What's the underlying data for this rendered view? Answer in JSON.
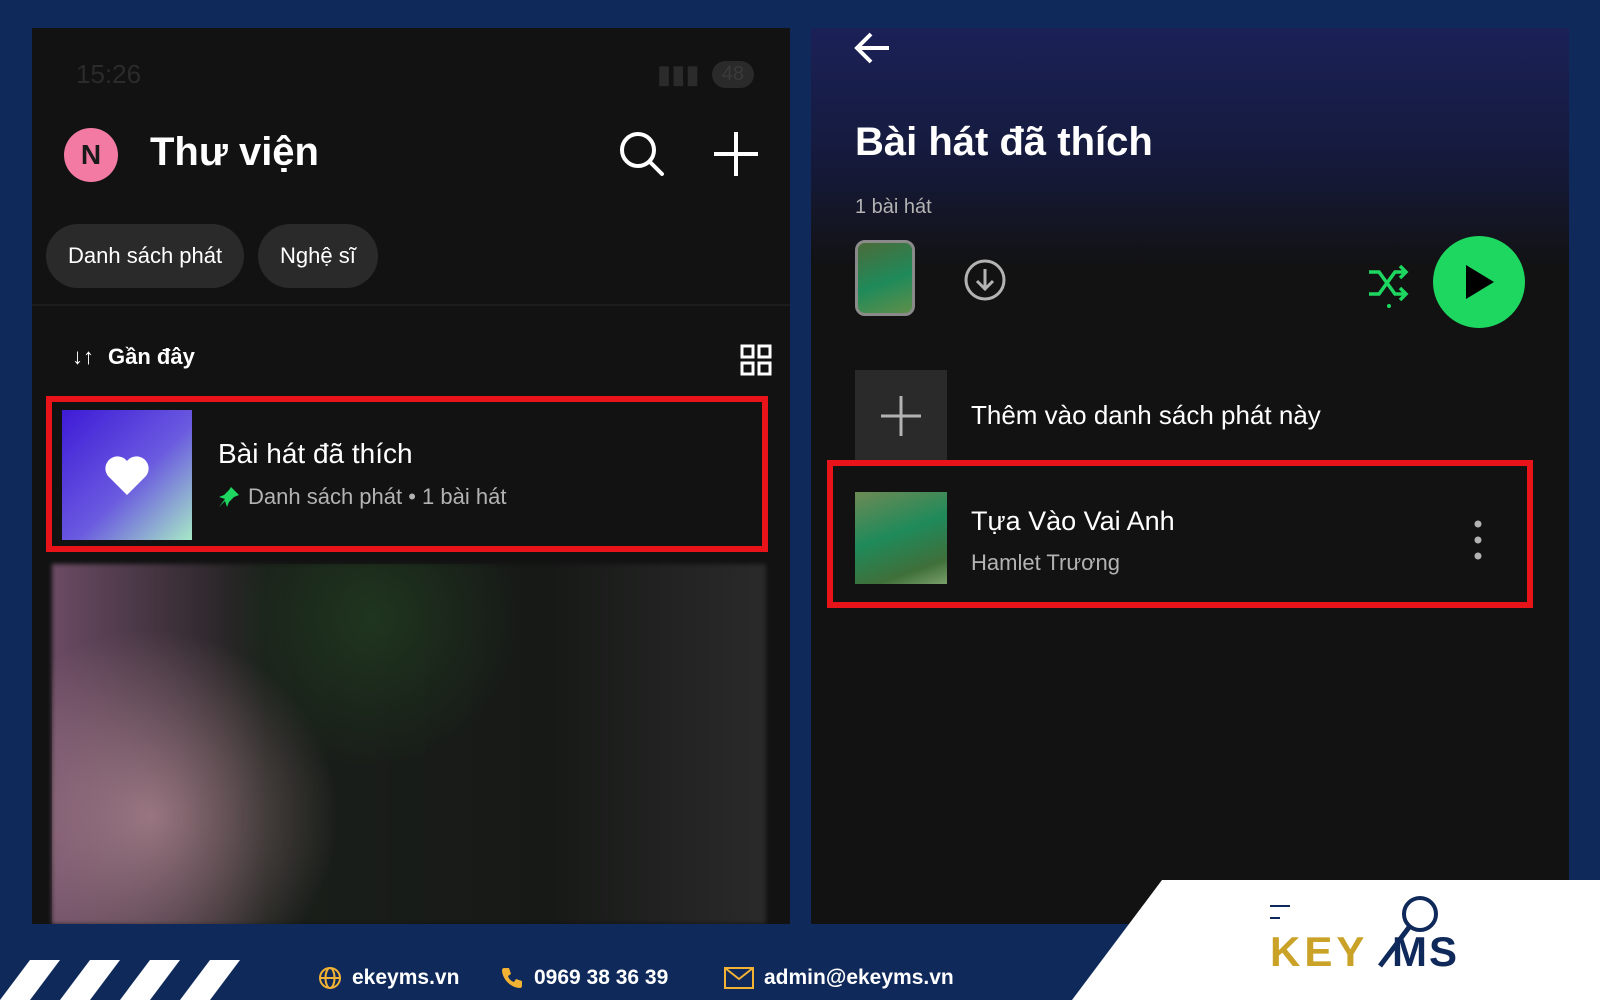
{
  "left_screen": {
    "status": {
      "time": "15:26",
      "battery": "48"
    },
    "avatar_letter": "N",
    "title": "Thư viện",
    "filters": [
      "Danh sách phát",
      "Nghệ sĩ"
    ],
    "sort_label": "Gần đây",
    "liked": {
      "title": "Bài hát đã thích",
      "subtitle": "Danh sách phát • 1 bài hát"
    }
  },
  "right_screen": {
    "title": "Bài hát đã thích",
    "count": "1 bài hát",
    "add_label": "Thêm vào danh sách phát này",
    "song": {
      "title": "Tựa Vào Vai Anh",
      "artist": "Hamlet Trương"
    }
  },
  "footer": {
    "website": "ekeyms.vn",
    "phone": "0969 38 36 39",
    "email": "admin@ekeyms.vn",
    "logo_text": "KEYMS"
  },
  "colors": {
    "accent_green": "#1ed760",
    "highlight_red": "#e8141a",
    "brand_navy": "#0f2a5a",
    "logo_gold": "#c9a227"
  }
}
